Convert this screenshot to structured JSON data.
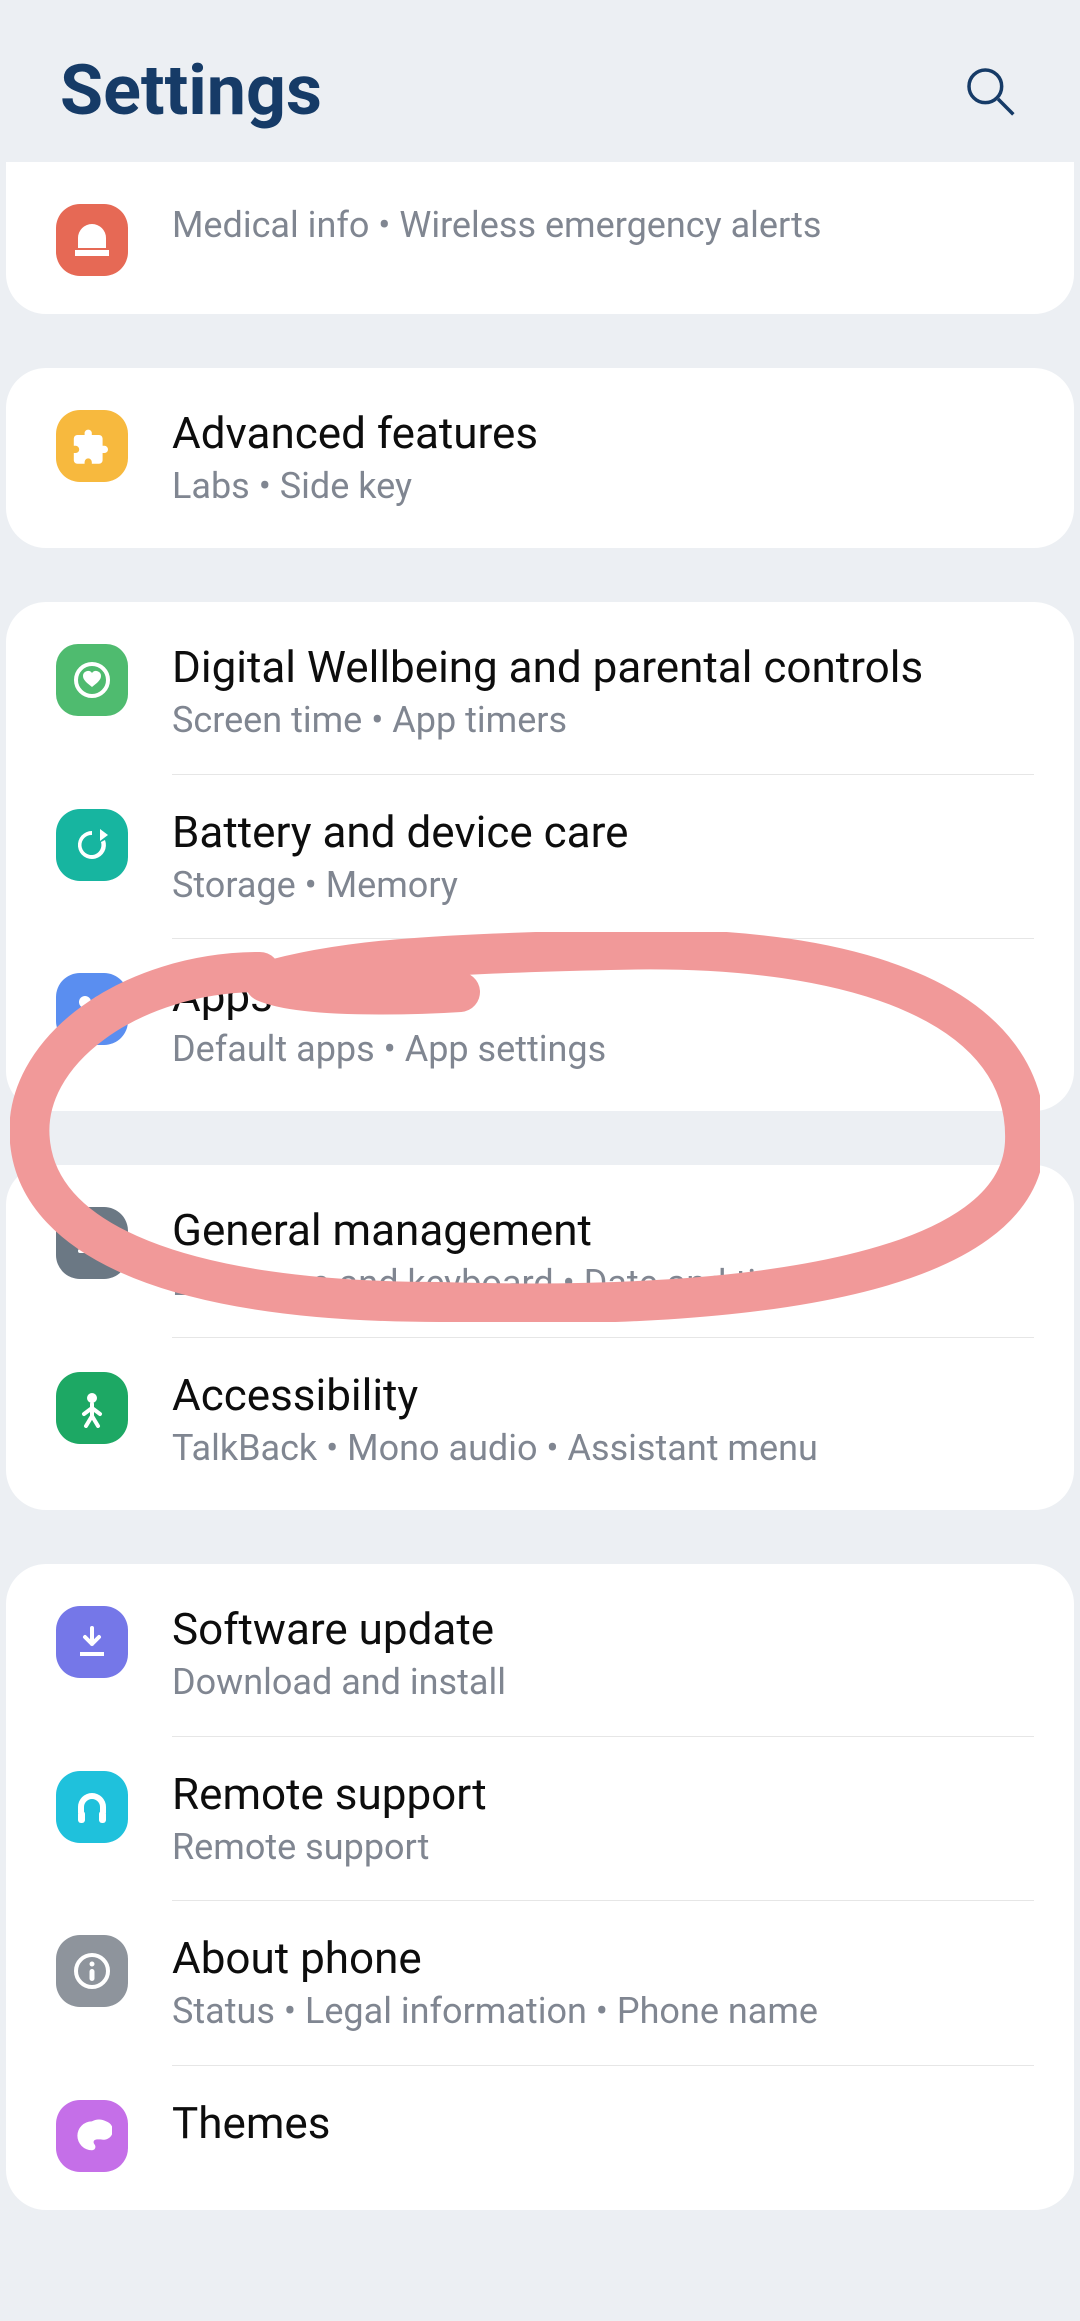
{
  "header": {
    "title": "Settings"
  },
  "groups": [
    {
      "class": "first",
      "items": [
        {
          "icon": "c-red",
          "svg": "siren",
          "title": null,
          "sub": "Medical info  •  Wireless emergency alerts"
        }
      ]
    },
    {
      "items": [
        {
          "icon": "c-yellow",
          "svg": "puzzle",
          "title": "Advanced features",
          "sub": "Labs  •  Side key"
        }
      ]
    },
    {
      "items": [
        {
          "icon": "c-lime",
          "svg": "heart-ring",
          "title": "Digital Wellbeing and parental controls",
          "sub": "Screen time  •  App timers"
        },
        {
          "icon": "c-teal",
          "svg": "refresh",
          "title": "Battery and device care",
          "sub": "Storage  •  Memory"
        },
        {
          "icon": "c-blue",
          "svg": "grid4",
          "title": "Apps",
          "sub": "Default apps  •  App settings"
        }
      ]
    },
    {
      "items": [
        {
          "icon": "c-gray",
          "svg": "sliders",
          "title": "General management",
          "sub": "Language and keyboard  •  Date and time"
        },
        {
          "icon": "c-green",
          "svg": "person",
          "title": "Accessibility",
          "sub": "TalkBack  •  Mono audio  •  Assistant menu"
        }
      ]
    },
    {
      "items": [
        {
          "icon": "c-purple",
          "svg": "download",
          "title": "Software update",
          "sub": "Download and install"
        },
        {
          "icon": "c-cyan",
          "svg": "headset",
          "title": "Remote support",
          "sub": "Remote support"
        },
        {
          "icon": "c-gray2",
          "svg": "info",
          "title": "About phone",
          "sub": "Status  •  Legal information  •  Phone name"
        },
        {
          "icon": "c-violet",
          "svg": "theme",
          "title": "Themes",
          "sub": ""
        }
      ]
    }
  ]
}
